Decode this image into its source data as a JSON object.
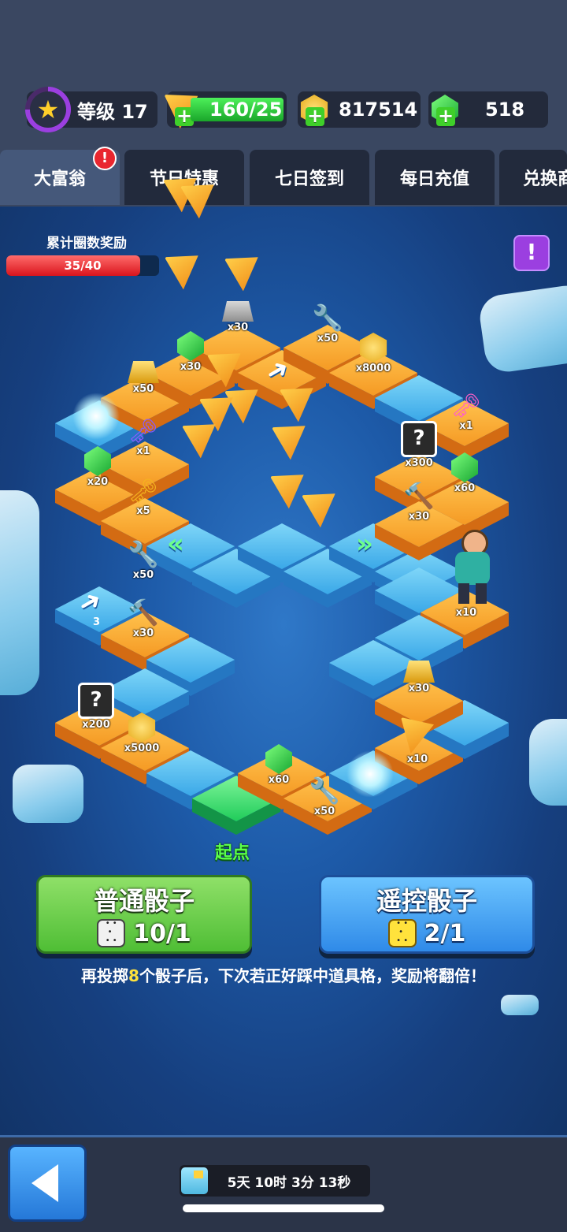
{
  "header": {
    "level_label": "等级 17",
    "pizza_value": "160/25",
    "coins_value": "817514",
    "gems_value": "518"
  },
  "tabs": [
    {
      "label": "大富翁",
      "active": true,
      "alert": "!"
    },
    {
      "label": "节日特惠"
    },
    {
      "label": "七日签到"
    },
    {
      "label": "每日充值"
    },
    {
      "label": "兑换商"
    }
  ],
  "progress": {
    "label": "累计圈数奖励",
    "text": "35/40",
    "fraction": 0.875
  },
  "info_button": "!",
  "board": {
    "start_label": "起点",
    "items": [
      {
        "icon": "ingot-icon",
        "qty": "x30"
      },
      {
        "icon": "wrench-icon",
        "qty": "x50"
      },
      {
        "icon": "coin-icon",
        "qty": "x8000"
      },
      {
        "icon": "gem-icon",
        "qty": "x30"
      },
      {
        "icon": "gold-bar-icon",
        "qty": "x50"
      },
      {
        "icon": "key-purple-icon",
        "qty": "x1"
      },
      {
        "icon": "gem-icon",
        "qty": "x20"
      },
      {
        "icon": "key-gold-icon",
        "qty": "x5"
      },
      {
        "icon": "wrench-icon",
        "qty": "x50"
      },
      {
        "icon": "hammer-icon",
        "qty": "x30"
      },
      {
        "icon": "mystery-box-icon",
        "qty": "x200"
      },
      {
        "icon": "coin-icon",
        "qty": "x5000"
      },
      {
        "icon": "gem-icon",
        "qty": "x60"
      },
      {
        "icon": "wrench-icon",
        "qty": "x50"
      },
      {
        "icon": "pizza-icon",
        "qty": "x10"
      },
      {
        "icon": "gold-bar-icon",
        "qty": "x30"
      },
      {
        "icon": "hero-character",
        "qty": "x10"
      },
      {
        "icon": "hammer-icon",
        "qty": "x30"
      },
      {
        "icon": "gem-icon",
        "qty": "x60"
      },
      {
        "icon": "mystery-box-icon",
        "qty": "x300"
      },
      {
        "icon": "key-pink-icon",
        "qty": "x1"
      }
    ],
    "arrow_number": "3"
  },
  "dice": {
    "normal": {
      "title": "普通骰子",
      "count": "10/1"
    },
    "remote": {
      "title": "遥控骰子",
      "count": "2/1"
    }
  },
  "hint": {
    "before": "再投掷",
    "number": "8",
    "after": "个骰子后，下次若正好踩中道具格，奖励将翻倍！"
  },
  "footer": {
    "timer": "5天 10时 3分 13秒"
  }
}
